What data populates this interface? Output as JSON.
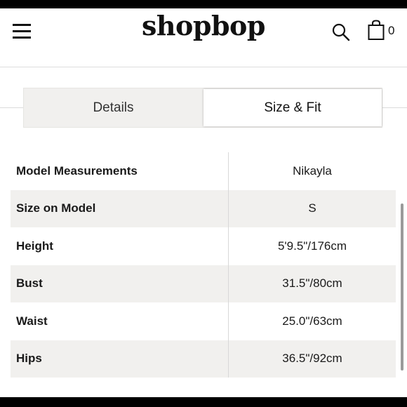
{
  "header": {
    "logo": "shopbop",
    "menu_icon": "hamburger-menu-icon",
    "search_icon": "search-icon",
    "bag_icon": "shopping-bag-icon",
    "bag_count": "0"
  },
  "tabs": [
    {
      "label": "Details",
      "active": false
    },
    {
      "label": "Size & Fit",
      "active": true
    }
  ],
  "measurements": {
    "header": {
      "label": "Model Measurements",
      "value": "Nikayla"
    },
    "rows": [
      {
        "label": "Size on Model",
        "value": "S"
      },
      {
        "label": "Height",
        "value": "5'9.5\"/176cm"
      },
      {
        "label": "Bust",
        "value": "31.5\"/80cm"
      },
      {
        "label": "Waist",
        "value": "25.0\"/63cm"
      },
      {
        "label": "Hips",
        "value": "36.5\"/92cm"
      }
    ]
  },
  "colors": {
    "background": "#ffffff",
    "stripe": "#f1f0ee",
    "text": "#1a1a1a"
  }
}
